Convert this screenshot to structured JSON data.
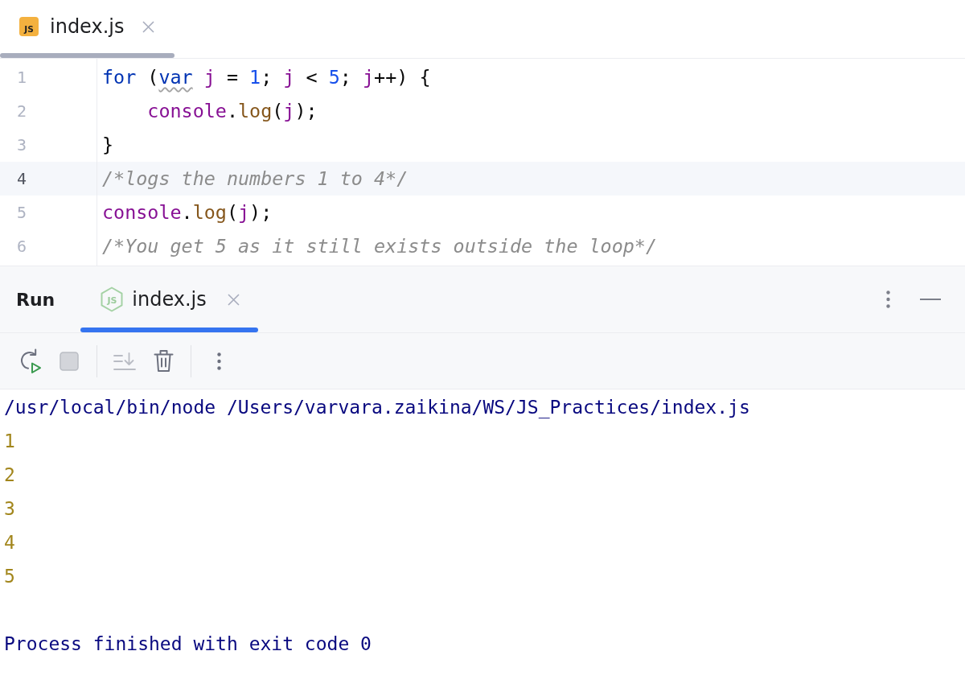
{
  "editor_tabs": [
    {
      "icon_text": "JS",
      "label": "index.js",
      "selected": true
    }
  ],
  "editor": {
    "lines": [
      {
        "number": "1",
        "current": false,
        "tokens": [
          {
            "kind": "keyword",
            "text": "for",
            "warning": false
          },
          {
            "kind": "plain",
            "text": " (",
            "warning": false
          },
          {
            "kind": "keyword",
            "text": "var",
            "warning": true
          },
          {
            "kind": "variable",
            "text": " j",
            "warning": false
          },
          {
            "kind": "plain",
            "text": " = ",
            "warning": false
          },
          {
            "kind": "number",
            "text": "1",
            "warning": false
          },
          {
            "kind": "plain",
            "text": "; ",
            "warning": false
          },
          {
            "kind": "variable",
            "text": "j",
            "warning": false
          },
          {
            "kind": "plain",
            "text": " < ",
            "warning": false
          },
          {
            "kind": "number",
            "text": "5",
            "warning": false
          },
          {
            "kind": "plain",
            "text": "; ",
            "warning": false
          },
          {
            "kind": "variable",
            "text": "j",
            "warning": false
          },
          {
            "kind": "plain",
            "text": "++) {",
            "warning": false
          }
        ]
      },
      {
        "number": "2",
        "current": false,
        "tokens": [
          {
            "kind": "variable",
            "text": "    console",
            "warning": false
          },
          {
            "kind": "plain",
            "text": ".",
            "warning": false
          },
          {
            "kind": "method",
            "text": "log",
            "warning": false
          },
          {
            "kind": "plain",
            "text": "(",
            "warning": false
          },
          {
            "kind": "variable",
            "text": "j",
            "warning": false
          },
          {
            "kind": "plain",
            "text": ");",
            "warning": false
          }
        ]
      },
      {
        "number": "3",
        "current": false,
        "tokens": [
          {
            "kind": "plain",
            "text": "}",
            "warning": false
          }
        ]
      },
      {
        "number": "4",
        "current": true,
        "tokens": [
          {
            "kind": "comment",
            "text": "/*logs the numbers 1 to 4*/",
            "warning": false
          }
        ]
      },
      {
        "number": "5",
        "current": false,
        "tokens": [
          {
            "kind": "variable",
            "text": "console",
            "warning": false
          },
          {
            "kind": "plain",
            "text": ".",
            "warning": false
          },
          {
            "kind": "method",
            "text": "log",
            "warning": false
          },
          {
            "kind": "plain",
            "text": "(",
            "warning": false
          },
          {
            "kind": "variable",
            "text": "j",
            "warning": false
          },
          {
            "kind": "plain",
            "text": ");",
            "warning": false
          }
        ]
      },
      {
        "number": "6",
        "current": false,
        "tokens": [
          {
            "kind": "comment",
            "text": "/*You get 5 as it still exists outside the loop*/",
            "warning": false
          }
        ]
      }
    ]
  },
  "run_window": {
    "title": "Run",
    "tabs": [
      {
        "icon_text": "JS",
        "label": "index.js",
        "selected": true
      }
    ],
    "toolbar": {
      "groups": [
        [
          {
            "kind": "rerun",
            "disabled": false
          },
          {
            "kind": "stop",
            "disabled": true
          }
        ],
        [
          {
            "kind": "scroll",
            "disabled": true
          },
          {
            "kind": "clear",
            "disabled": false
          }
        ],
        [
          {
            "kind": "more",
            "disabled": false
          }
        ]
      ]
    },
    "console": [
      {
        "kind": "system",
        "text": "/usr/local/bin/node /Users/varvara.zaikina/WS/JS_Practices/index.js"
      },
      {
        "kind": "output",
        "text": "1"
      },
      {
        "kind": "output",
        "text": "2"
      },
      {
        "kind": "output",
        "text": "3"
      },
      {
        "kind": "output",
        "text": "4"
      },
      {
        "kind": "output",
        "text": "5"
      },
      {
        "kind": "blank"
      },
      {
        "kind": "system",
        "text": "Process finished with exit code 0"
      }
    ]
  }
}
